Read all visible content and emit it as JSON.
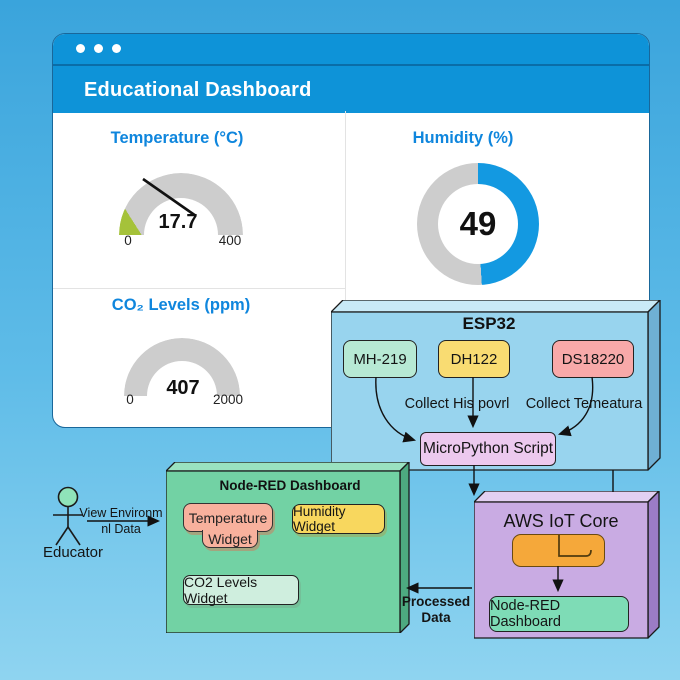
{
  "window": {
    "title": "Educational Dashboard"
  },
  "chart_data": [
    {
      "type": "gauge",
      "title": "Temperature (°C)",
      "value": "17.7",
      "ticks": [
        "0",
        "400"
      ],
      "green_fraction": 0.32,
      "has_needle": true
    },
    {
      "type": "donut",
      "title": "Humidity (%)",
      "value": "49",
      "value_percent": 49
    },
    {
      "type": "gauge",
      "title": "CO₂ Levels (ppm)",
      "value": "407",
      "ticks": [
        "0",
        "2000"
      ],
      "green_fraction": 0.2,
      "has_needle": false
    }
  ],
  "diagram": {
    "esp32": {
      "title": "ESP32",
      "sensors": [
        "MH-219",
        "DH122",
        "DS18220"
      ],
      "collect_left": "Collect His povrl",
      "collect_right": "Collect Temeatura",
      "script": "MicroPython Script"
    },
    "aws": {
      "title": "AWS IoT Core",
      "dashboard": "Node-RED Dashboard"
    },
    "nodered": {
      "title": "Node-RED Dashboard",
      "widget_temperature_line1": "Temperature",
      "widget_temperature_line2": "Widget",
      "widget_humidity": "Humidity Widget",
      "widget_co2": "CO2 Levels Widget"
    },
    "educator": {
      "label": "Educator",
      "arrow_label_line1": "View Environm",
      "arrow_label_line2": "nl Data"
    },
    "processed_label_line1": "Processed",
    "processed_label_line2": "Data"
  },
  "colors": {
    "background_top": "#3aa4dc",
    "background_bottom": "#8fd4f0",
    "header_blue": "#0e93d8",
    "panel_title_blue": "#0f86dd",
    "gauge_green": "#a5c23a",
    "gauge_gray": "#cdcdcd",
    "donut_blue": "#1399e1",
    "donut_gray": "#cdcdcd",
    "esp32_face": "#98d4ee",
    "aws_face": "#c9abe3",
    "nodered_face": "#72d2a4",
    "sensor_mint": "#b7e9d4",
    "sensor_yellow": "#f9dc72",
    "sensor_salmon": "#f8a9a9",
    "micropython_pink": "#ecc9ee",
    "orange_icon": "#f5a83a",
    "aws_green_box": "#7edcb6",
    "widget_salmon": "#f8b19d",
    "widget_yellow": "#f8d75e",
    "widget_mint": "#cfeede"
  }
}
